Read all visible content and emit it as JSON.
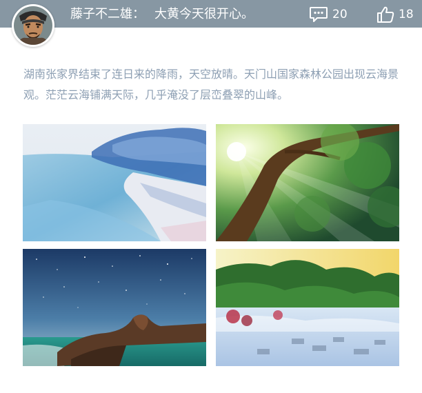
{
  "post": {
    "author": "藤子不二雄：",
    "title": "大黄今天很开心。",
    "description": "湖南张家界结束了连日来的降雨，天空放晴。天门山国家森林公园出现云海景观。茫茫云海铺满天际，几乎淹没了层峦叠翠的山峰。"
  },
  "stats": {
    "comments": "20",
    "likes": "18"
  },
  "icons": {
    "comment": "comment-bubble-icon",
    "like": "thumbs-up-icon"
  },
  "colors": {
    "header_bg": "#8797a3",
    "description_text": "#8d9fb3"
  },
  "photos": [
    {
      "subject": "watercolor-beach"
    },
    {
      "subject": "sunlight-through-tree"
    },
    {
      "subject": "starry-sky-rocky-coast"
    },
    {
      "subject": "misty-mountain-village"
    }
  ]
}
